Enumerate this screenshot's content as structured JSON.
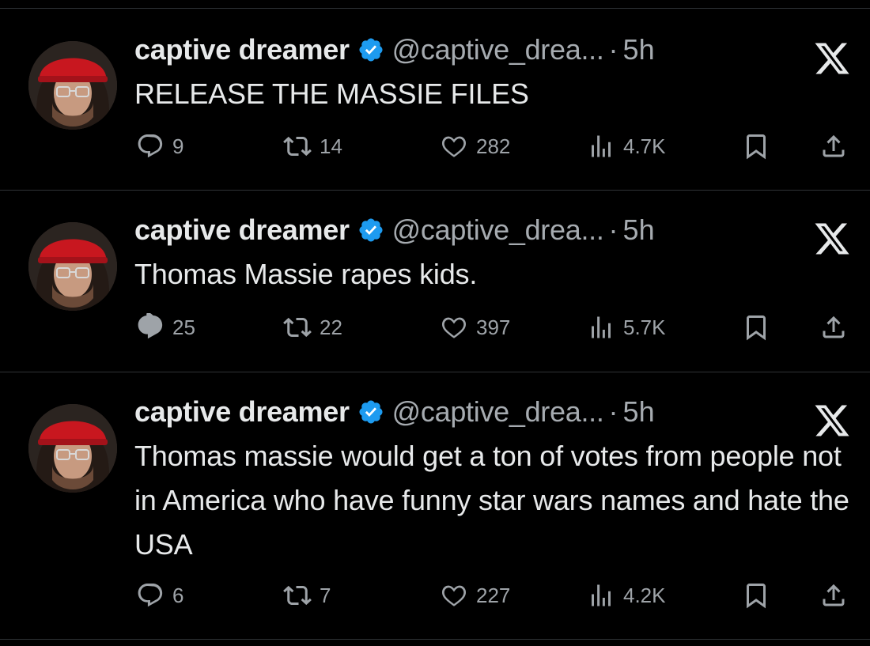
{
  "colors": {
    "background": "#000000",
    "divider": "#2f3336",
    "text_primary": "#e7e9ea",
    "text_secondary": "#a6abb0",
    "verified_badge": "#1d9bf0"
  },
  "icons": [
    "reply-icon",
    "retweet-icon",
    "like-icon",
    "views-icon",
    "bookmark-icon",
    "share-icon",
    "x-logo-icon",
    "verified-badge-icon"
  ],
  "tweets": [
    {
      "name": "captive dreamer",
      "handle": "@captive_drea...",
      "separator": "·",
      "time": "5h",
      "text": "RELEASE THE MASSIE FILES",
      "replies": "9",
      "reposts": "14",
      "likes": "282",
      "views": "4.7K"
    },
    {
      "name": "captive dreamer",
      "handle": "@captive_drea...",
      "separator": "·",
      "time": "5h",
      "text": "Thomas Massie rapes kids.",
      "replies": "25",
      "reposts": "22",
      "likes": "397",
      "views": "5.7K"
    },
    {
      "name": "captive dreamer",
      "handle": "@captive_drea...",
      "separator": "·",
      "time": "5h",
      "text": "Thomas massie would get a ton of votes from people not in America who have funny star wars names and hate the USA",
      "replies": "6",
      "reposts": "7",
      "likes": "227",
      "views": "4.2K"
    }
  ]
}
